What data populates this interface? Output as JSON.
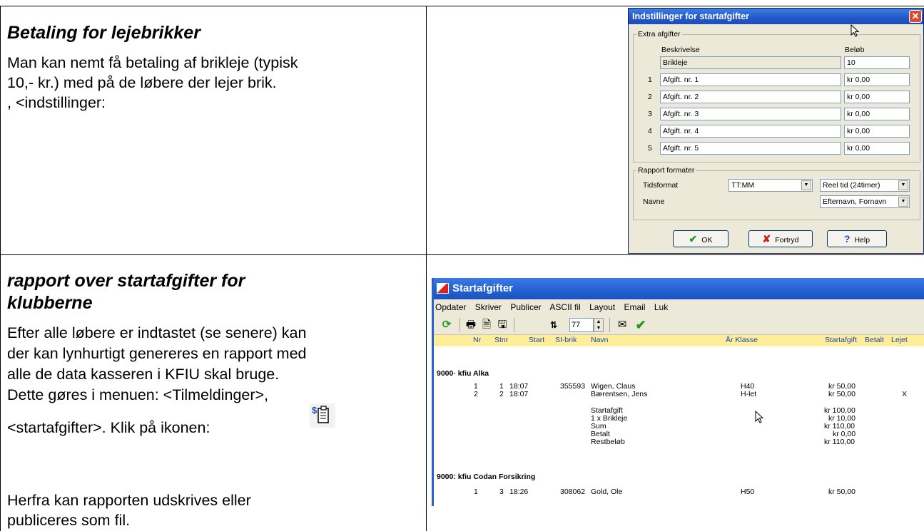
{
  "section1": {
    "heading": "Betaling for lejebrikker",
    "para1": "Man kan nemt få betaling af brikleje (typisk",
    "para2": "10,- kr.) med på de løbere der lejer brik.",
    "para3": ", <indstillinger:"
  },
  "section2": {
    "heading1": "rapport over startafgifter for",
    "heading2": "klubberne",
    "lines": [
      "Efter alle løbere er indtastet (se senere) kan",
      "der kan lynhurtigt genereres en rapport med",
      "alle de data kasseren i KFIU skal bruge.",
      "Dette gøres i menuen: <Tilmeldinger>,",
      "<startafgifter>. Klik på ikonen:"
    ],
    "closing1": "Herfra kan rapporten udskrives eller",
    "closing2": "publiceres som fil."
  },
  "dialog": {
    "title": "Indstillinger for startafgifter",
    "extra_group": "Extra afgifter",
    "col_desc": "Beskrivelse",
    "col_amount": "Beløb",
    "brikleje_desc": "Brikleje",
    "brikleje_amount": "10",
    "fees": [
      {
        "num": "1",
        "desc": "Afgift. nr. 1",
        "amount": "kr 0,00"
      },
      {
        "num": "2",
        "desc": "Afgift. nr. 2",
        "amount": "kr 0,00"
      },
      {
        "num": "3",
        "desc": "Afgift. nr. 3",
        "amount": "kr 0,00"
      },
      {
        "num": "4",
        "desc": "Afgift. nr. 4",
        "amount": "kr 0,00"
      },
      {
        "num": "5",
        "desc": "Afgift. nr. 5",
        "amount": "kr 0,00"
      }
    ],
    "report_group": "Rapport formater",
    "time_label": "Tidsformat",
    "time_value": "TT:MM",
    "time_mode": "Reel tid (24timer)",
    "names_label": "Navne",
    "names_value": "Efternavn, Fornavn",
    "ok": "OK",
    "cancel": "Fortryd",
    "help": "Help"
  },
  "report": {
    "title": "Startafgifter",
    "menu": [
      "Opdater",
      "Skriver",
      "Publicer",
      "ASCII fil",
      "Layout",
      "Email",
      "Luk"
    ],
    "zoom": "77",
    "headers": {
      "nr": "Nr",
      "stnr": "Stnr",
      "start": "Start",
      "si": "SI-brik",
      "navn": "Navn",
      "klasse": "År Klasse",
      "afgift": "Startafgift",
      "betalt": "Betalt",
      "lejet": "Lejet"
    },
    "club1": "9000· kfiu Alka",
    "rows1": [
      {
        "nr": "1",
        "stnr": "1",
        "start": "18:07",
        "si": "355593",
        "navn": "Wigen, Claus",
        "klasse": "H40",
        "afgift": "kr 50,00",
        "lejet": ""
      },
      {
        "nr": "2",
        "stnr": "2",
        "start": "18:07",
        "si": "",
        "navn": "Bærentsen, Jens",
        "klasse": "H-let",
        "afgift": "kr 50,00",
        "lejet": "X"
      }
    ],
    "summary": [
      {
        "label": "Startafgift",
        "value": "kr 100,00"
      },
      {
        "label": "1 x Brikleje",
        "value": "kr 10,00"
      },
      {
        "label": "Sum",
        "value": "kr 110,00"
      },
      {
        "label": "Betalt",
        "value": "kr 0,00"
      },
      {
        "label": "Restbeløb",
        "value": "kr 110,00"
      }
    ],
    "club2": "9000: kfiu Codan Forsikring",
    "row3": {
      "nr": "1",
      "stnr": "3",
      "start": "18:26",
      "si": "308062",
      "navn": "Gold, Ole",
      "klasse": "H50",
      "afgift": "kr 50,00"
    }
  }
}
